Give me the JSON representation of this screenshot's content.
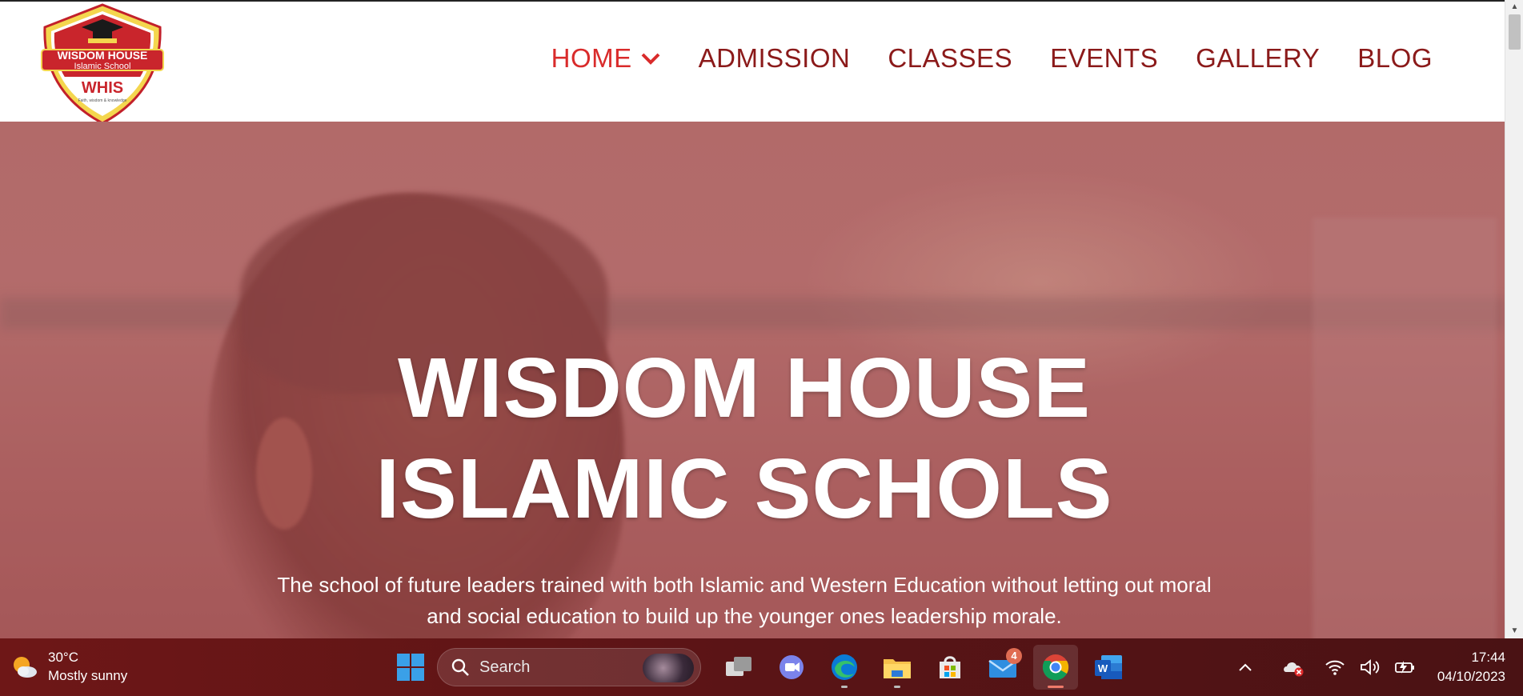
{
  "header": {
    "logo": {
      "title": "WISDOM HOUSE",
      "subtitle": "Islamic School",
      "abbr": "WHIS",
      "motto": "Faith, wisdom & knowledge"
    },
    "nav": [
      {
        "label": "HOME",
        "active": true
      },
      {
        "label": "ADMISSION"
      },
      {
        "label": "CLASSES"
      },
      {
        "label": "EVENTS"
      },
      {
        "label": "GALLERY"
      },
      {
        "label": "BLOG"
      }
    ]
  },
  "hero": {
    "title_line1": "WISDOM HOUSE",
    "title_line2": "ISLAMIC SCHOLS",
    "subtitle_line1": "The school of future leaders trained with both Islamic and Western Education without letting out moral",
    "subtitle_line2": "and social education to build up the younger ones leadership morale."
  },
  "colors": {
    "brand_red": "#d92b2b",
    "nav_text": "#8b1a1a",
    "taskbar_bg": "#5a1416"
  },
  "taskbar": {
    "weather": {
      "temp": "30°C",
      "desc": "Mostly sunny",
      "icon": "sun-cloud-icon"
    },
    "search": {
      "placeholder": "Search"
    },
    "apps": [
      {
        "name": "task-view-icon"
      },
      {
        "name": "teams-chat-icon"
      },
      {
        "name": "edge-icon"
      },
      {
        "name": "file-explorer-icon"
      },
      {
        "name": "ms-store-icon"
      },
      {
        "name": "mail-icon",
        "badge": "4"
      },
      {
        "name": "chrome-icon",
        "active": true
      },
      {
        "name": "word-icon"
      }
    ],
    "clock": {
      "time": "17:44",
      "date": "04/10/2023"
    }
  }
}
